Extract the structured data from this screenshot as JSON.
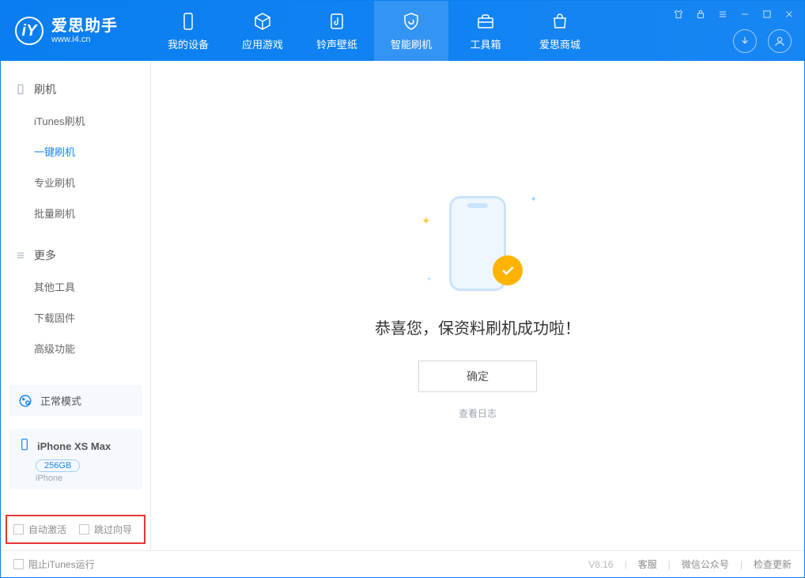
{
  "app": {
    "name_cn": "爱思助手",
    "name_en": "www.i4.cn",
    "logo_letter": "iY"
  },
  "tabs": [
    {
      "label": "我的设备"
    },
    {
      "label": "应用游戏"
    },
    {
      "label": "铃声壁纸"
    },
    {
      "label": "智能刷机"
    },
    {
      "label": "工具箱"
    },
    {
      "label": "爱思商城"
    }
  ],
  "sidebar": {
    "group1": {
      "title": "刷机",
      "items": [
        "iTunes刷机",
        "一键刷机",
        "专业刷机",
        "批量刷机"
      ],
      "active_index": 1
    },
    "group2": {
      "title": "更多",
      "items": [
        "其他工具",
        "下载固件",
        "高级功能"
      ]
    }
  },
  "mode": {
    "label": "正常模式"
  },
  "device": {
    "name": "iPhone XS Max",
    "capacity": "256GB",
    "type": "iPhone"
  },
  "options": {
    "auto_activate": "自动激活",
    "skip_guide": "跳过向导"
  },
  "main": {
    "headline": "恭喜您，保资料刷机成功啦！",
    "ok": "确定",
    "view_log": "查看日志"
  },
  "status": {
    "block_itunes": "阻止iTunes运行",
    "version": "V8.16",
    "support": "客服",
    "wechat": "微信公众号",
    "update": "检查更新"
  }
}
